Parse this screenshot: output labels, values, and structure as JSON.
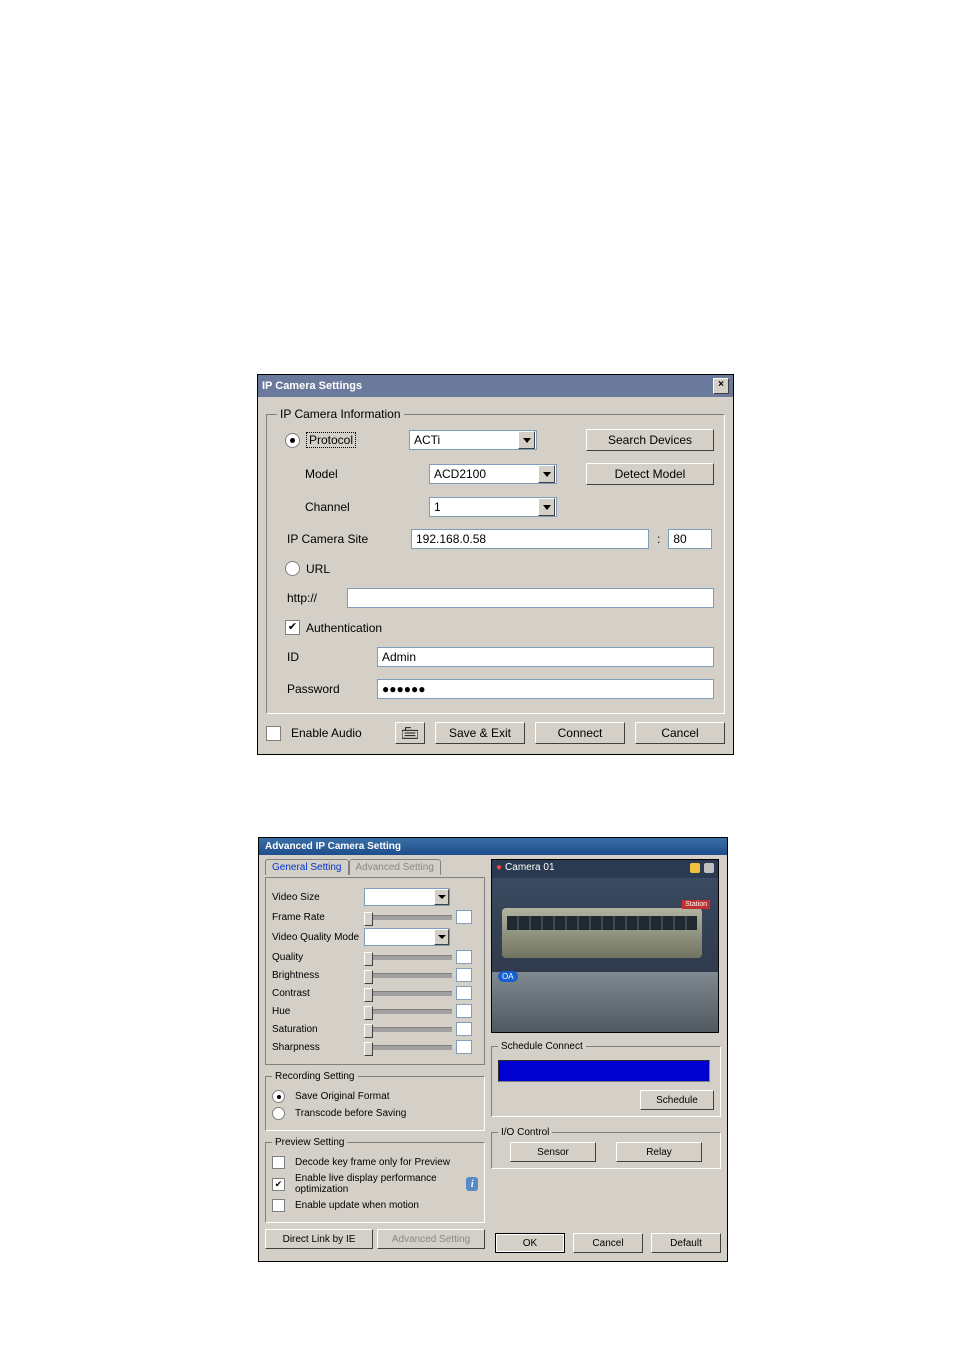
{
  "dialog1": {
    "title": "IP Camera Settings",
    "group_title": "IP Camera Information",
    "protocol_label": "Protocol",
    "protocol_value": "ACTi",
    "search_devices": "Search Devices",
    "model_label": "Model",
    "model_value": "ACD2100",
    "detect_model": "Detect Model",
    "channel_label": "Channel",
    "channel_value": "1",
    "site_label": "IP Camera Site",
    "site_value": "192.168.0.58",
    "port_sep": ":",
    "port_value": "80",
    "url_label": "URL",
    "url_prefix": "http://",
    "auth_label": "Authentication",
    "id_label": "ID",
    "id_value": "Admin",
    "password_label": "Password",
    "password_value": "●●●●●●",
    "enable_audio": "Enable Audio",
    "save_exit": "Save & Exit",
    "connect": "Connect",
    "cancel": "Cancel"
  },
  "dialog2": {
    "title": "Advanced IP Camera Setting",
    "tab1": "General Setting",
    "tab2": "Advanced Setting",
    "video_size": "Video Size",
    "frame_rate": "Frame Rate",
    "video_quality_mode": "Video Quality Mode",
    "quality": "Quality",
    "brightness": "Brightness",
    "contrast": "Contrast",
    "hue": "Hue",
    "saturation": "Saturation",
    "sharpness": "Sharpness",
    "recording_setting": "Recording Setting",
    "save_original": "Save Original Format",
    "transcode": "Transcode before Saving",
    "preview_setting": "Preview Setting",
    "decode_key": "Decode key frame only for Preview",
    "enable_live": "Enable live display performance optimization",
    "enable_update": "Enable update when motion",
    "direct_link": "Direct Link by IE",
    "advanced_setting_btn": "Advanced Setting",
    "camera_label": "Camera 01",
    "oa_badge": "OA",
    "station_sign": "Station",
    "schedule_connect": "Schedule Connect",
    "schedule": "Schedule",
    "io_control": "I/O Control",
    "sensor": "Sensor",
    "relay": "Relay",
    "ok": "OK",
    "cancel": "Cancel",
    "default": "Default"
  }
}
